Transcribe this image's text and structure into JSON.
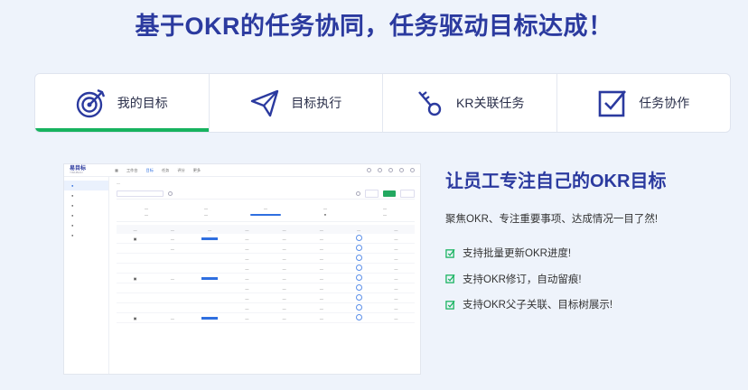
{
  "headline": "基于OKR的任务协同，任务驱动目标达成！",
  "tabs": [
    {
      "label": "我的目标",
      "icon": "target-icon",
      "active": true
    },
    {
      "label": "目标执行",
      "icon": "paper-plane-icon",
      "active": false
    },
    {
      "label": "KR关联任务",
      "icon": "key-link-icon",
      "active": false
    },
    {
      "label": "任务协作",
      "icon": "checkbox-icon",
      "active": false
    }
  ],
  "feature": {
    "title": "让员工专注自己的OKR目标",
    "description": "聚焦OKR、专注重要事项、达成情况一目了然!",
    "bullets": [
      "支持批量更新OKR进度!",
      "支持OKR修订，自动留痕!",
      "支持OKR父子关联、目标树展示!"
    ]
  },
  "colors": {
    "brand": "#2b3a9f",
    "accent": "#17b35f",
    "link": "#2f6fe0"
  }
}
